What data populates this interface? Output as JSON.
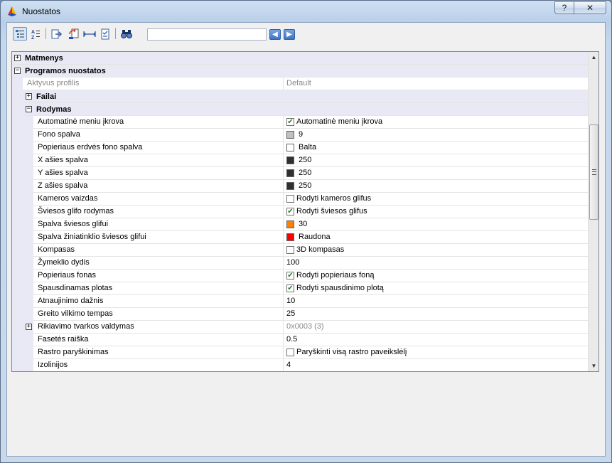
{
  "window": {
    "title": "Nuostatos",
    "help_label": "?",
    "close_label": "✕"
  },
  "toolbar": {
    "icons": [
      "categorized-icon",
      "alphabetical-icon",
      "export-icon",
      "import-icon",
      "dimension-icon",
      "checklist-icon",
      "find-icon"
    ],
    "search_value": "",
    "prev_label": "◀",
    "next_label": "▶"
  },
  "grid": {
    "categories": {
      "matmenys": {
        "label": "Matmenys",
        "expander": "+"
      },
      "programos": {
        "label": "Programos nuostatos",
        "expander": "−"
      },
      "failai": {
        "label": "Failai",
        "expander": "+"
      },
      "rodymas": {
        "label": "Rodymas",
        "expander": "−"
      }
    },
    "profile": {
      "name": "Aktyvus profilis",
      "value": "Default"
    },
    "rows": [
      {
        "name": "Automatinė meniu įkrova",
        "kind": "check",
        "checked": true,
        "value": "Automatinė meniu įkrova"
      },
      {
        "name": "Fono spalva",
        "kind": "color",
        "color": "#c0c0c0",
        "value": "9"
      },
      {
        "name": "Popieriaus erdvės fono spalva",
        "kind": "color",
        "color": "#ffffff",
        "value": "Balta"
      },
      {
        "name": "X ašies spalva",
        "kind": "color",
        "color": "#303030",
        "value": "250"
      },
      {
        "name": "Y ašies spalva",
        "kind": "color",
        "color": "#303030",
        "value": "250"
      },
      {
        "name": "Z ašies spalva",
        "kind": "color",
        "color": "#303030",
        "value": "250"
      },
      {
        "name": "Kameros vaizdas",
        "kind": "check",
        "checked": false,
        "value": "Rodyti kameros glifus"
      },
      {
        "name": "Šviesos glifo rodymas",
        "kind": "check",
        "checked": true,
        "value": "Rodyti šviesos glifus"
      },
      {
        "name": "Spalva šviesos glifui",
        "kind": "color",
        "color": "#ff8000",
        "value": "30"
      },
      {
        "name": "Spalva žiniatinklio šviesos glifui",
        "kind": "color",
        "color": "#ff0000",
        "value": "Raudona"
      },
      {
        "name": "Kompasas",
        "kind": "check",
        "checked": false,
        "value": "3D kompasas"
      },
      {
        "name": "Žymeklio dydis",
        "kind": "text",
        "value": "100"
      },
      {
        "name": "Popieriaus fonas",
        "kind": "check",
        "checked": true,
        "value": "Rodyti popieriaus foną"
      },
      {
        "name": "Spausdinamas plotas",
        "kind": "check",
        "checked": true,
        "value": "Rodyti spausdinimo plotą"
      },
      {
        "name": "Atnaujinimo dažnis",
        "kind": "text",
        "value": "10"
      },
      {
        "name": "Greito vilkimo tempas",
        "kind": "text",
        "value": "25"
      },
      {
        "name": "Rikiavimo tvarkos valdymas",
        "kind": "text",
        "dim": true,
        "expandable": true,
        "value": "0x0003 (3)"
      },
      {
        "name": "Fasetės raiška",
        "kind": "text",
        "value": "0.5"
      },
      {
        "name": "Rastro paryškinimas",
        "kind": "check",
        "checked": false,
        "value": "Paryškinti visą rastro paveikslėlį"
      },
      {
        "name": "Izolinijos",
        "kind": "text",
        "value": "4"
      }
    ],
    "scroll": {
      "up": "▲",
      "down": "▼"
    }
  }
}
